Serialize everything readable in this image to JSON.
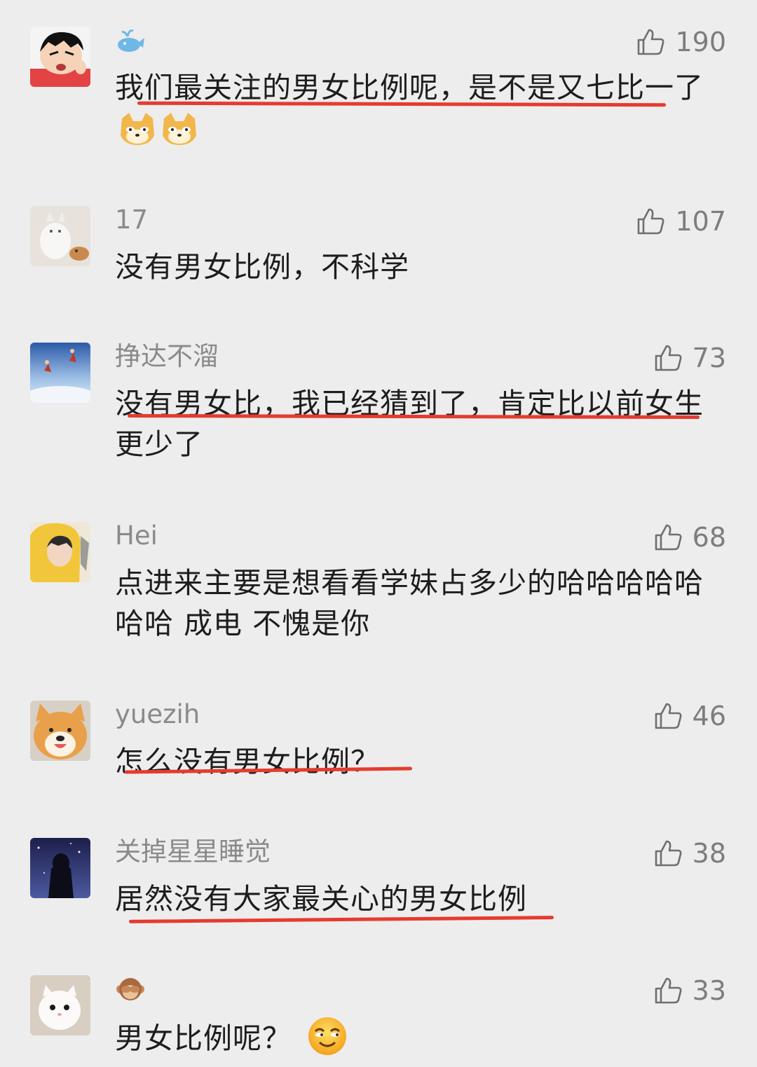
{
  "comments": [
    {
      "username": "",
      "username_icon": "whale-icon",
      "likes": "190",
      "text": "我们最关注的男女比例呢，是不是又七比一了",
      "trailing_emoji": [
        "doge-emoji",
        "doge-emoji"
      ]
    },
    {
      "username": "17",
      "likes": "107",
      "text": "没有男女比例，不科学"
    },
    {
      "username": "挣达不溜",
      "likes": "73",
      "text": "没有男女比，我已经猜到了，肯定比以前女生更少了"
    },
    {
      "username": "Hei",
      "likes": "68",
      "text": "点进来主要是想看看学妹占多少的哈哈哈哈哈哈哈 成电 不愧是你"
    },
    {
      "username": "yuezih",
      "likes": "46",
      "text": "怎么没有男女比例？"
    },
    {
      "username": "关掉星星睡觉",
      "likes": "38",
      "text": "居然没有大家最关心的男女比例"
    },
    {
      "username": "",
      "username_icon": "monkey-icon",
      "likes": "33",
      "text": "男女比例呢？",
      "trailing_emoji": [
        "grinning-face-emoji"
      ]
    }
  ],
  "colors": {
    "background": "#ededed",
    "username": "#8a8a8a",
    "like": "#7d7d7d",
    "text": "#1d1d1d",
    "underline": "#e53b2f"
  }
}
